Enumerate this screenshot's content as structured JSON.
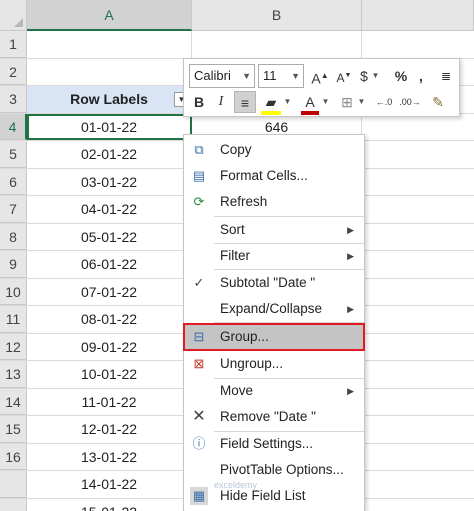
{
  "columns": [
    "A",
    "B"
  ],
  "row_numbers": [
    "1",
    "2",
    "3",
    "4",
    "5",
    "6",
    "7",
    "8",
    "9",
    "10",
    "11",
    "12",
    "13",
    "14",
    "15",
    "16"
  ],
  "header_cell": "Row Labels",
  "first_value": "646",
  "dates": [
    "01-01-22",
    "02-01-22",
    "03-01-22",
    "04-01-22",
    "05-01-22",
    "06-01-22",
    "07-01-22",
    "08-01-22",
    "09-01-22",
    "10-01-22",
    "11-01-22",
    "12-01-22",
    "13-01-22",
    "14-01-22",
    "15-01-22"
  ],
  "mini_toolbar": {
    "font_name": "Calibri",
    "font_size": "11"
  },
  "menu": {
    "copy": "Copy",
    "format_cells": "Format Cells...",
    "refresh": "Refresh",
    "sort": "Sort",
    "filter": "Filter",
    "subtotal": "Subtotal \"Date \"",
    "expand_collapse": "Expand/Collapse",
    "group": "Group...",
    "ungroup": "Ungroup...",
    "move": "Move",
    "remove": "Remove \"Date \"",
    "field_settings": "Field Settings...",
    "pivot_options": "PivotTable Options...",
    "hide_field_list": "Hide Field List"
  },
  "icons": {
    "copy": "copy-icon",
    "format_cells": "format-cells-icon",
    "refresh": "refresh-icon",
    "check": "check-icon",
    "group": "group-icon",
    "ungroup": "ungroup-icon",
    "remove": "remove-icon",
    "field_settings": "field-settings-icon",
    "hide_field_list": "field-list-icon"
  },
  "watermark": "exceldemy",
  "colors": {
    "accent_green": "#217346",
    "header_fill": "#d9e5f4",
    "highlight_border": "#e01b24",
    "font_color_red": "#c00000",
    "highlight_yellow": "#ffff00"
  }
}
